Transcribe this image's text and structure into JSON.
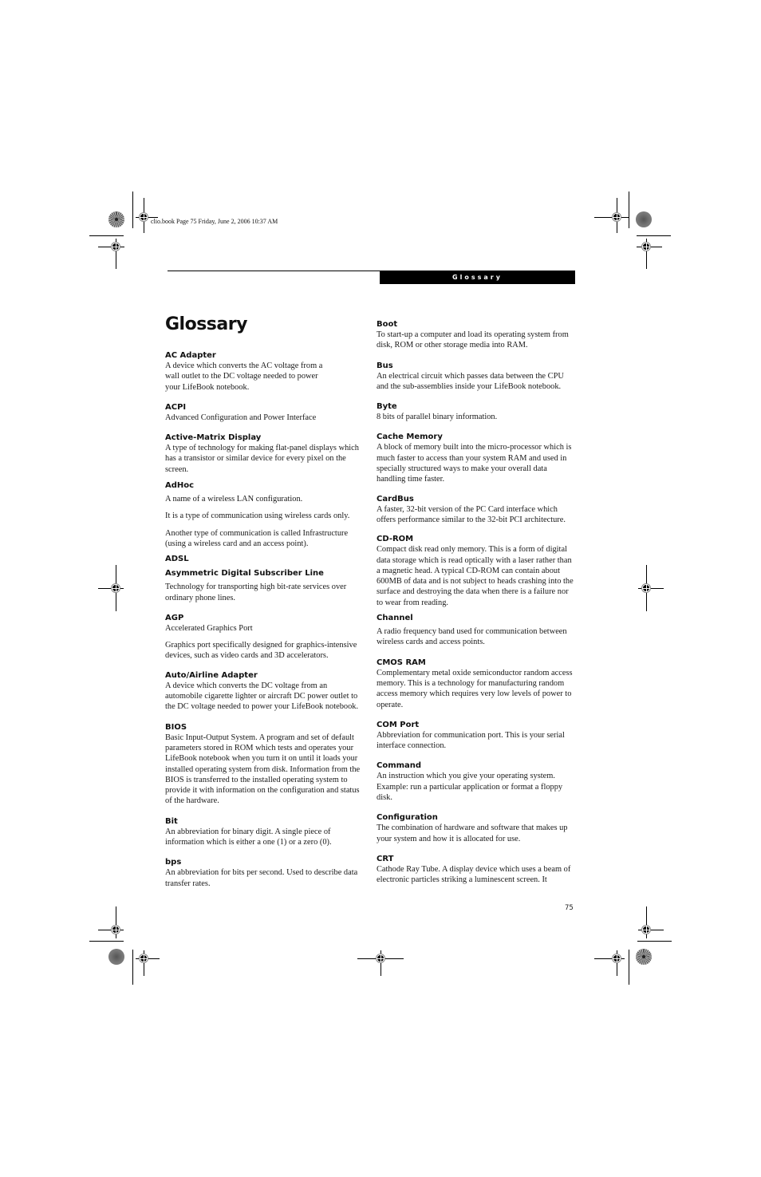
{
  "slug": "clio.book  Page 75  Friday, June 2, 2006  10:37 AM",
  "running_header": "Glossary",
  "page_title": "Glossary",
  "page_number": "75",
  "left_column": [
    {
      "term": "AC Adapter",
      "paragraphs": [
        "A device which converts the AC voltage from a",
        "wall outlet to the DC voltage needed to power",
        "your LifeBook notebook."
      ]
    },
    {
      "term": "ACPI",
      "paragraphs": [
        "Advanced Configuration and Power Interface"
      ]
    },
    {
      "term": "Active-Matrix Display",
      "paragraphs": [
        "A type of technology for making flat-panel displays which has a transistor or similar device for every pixel on the screen."
      ]
    },
    {
      "term": "AdHoc",
      "paragraphs": [
        "A name of a wireless LAN configuration.",
        "It is a type of communication using wireless cards only.",
        "Another type of communication is called Infrastructure (using a wireless card and an access point)."
      ]
    },
    {
      "term": "ADSL",
      "subterm": "Asymmetric Digital Subscriber Line",
      "paragraphs": [
        "Technology for transporting high bit-rate services over ordinary phone lines."
      ]
    },
    {
      "term": "AGP",
      "paragraphs": [
        "Accelerated Graphics Port",
        "Graphics port specifically designed for graphics-intensive devices, such as video cards and 3D accelerators."
      ]
    },
    {
      "term": "Auto/Airline Adapter",
      "paragraphs": [
        "A device which converts the DC voltage from an automobile cigarette lighter or aircraft DC power outlet to the DC voltage needed to power your LifeBook notebook."
      ]
    },
    {
      "term": "BIOS",
      "paragraphs": [
        "Basic Input-Output System. A program and set of default parameters stored in ROM which tests and operates your LifeBook notebook when you turn it on until it loads your installed operating system from disk. Information from the BIOS is transferred to the installed operating system to provide it with information on the configuration and status of the hardware."
      ]
    },
    {
      "term": "Bit",
      "paragraphs": [
        "An abbreviation for binary digit. A single piece of information which is either a one (1) or a zero (0)."
      ]
    },
    {
      "term": "bps",
      "paragraphs": [
        "An abbreviation for bits per second. Used to describe data transfer rates."
      ]
    }
  ],
  "right_column": [
    {
      "term": "Boot",
      "paragraphs": [
        "To start-up a computer and load its operating system from disk, ROM or other storage media into RAM."
      ]
    },
    {
      "term": "Bus",
      "paragraphs": [
        "An electrical circuit which passes data between the CPU and the sub-assemblies inside your LifeBook notebook."
      ]
    },
    {
      "term": "Byte",
      "paragraphs": [
        "8 bits of parallel binary information."
      ]
    },
    {
      "term": "Cache Memory",
      "paragraphs": [
        "A block of memory built into the micro-processor which is much faster to access than your system RAM and used in specially structured ways to make your overall data handling time faster."
      ]
    },
    {
      "term": "CardBus",
      "paragraphs": [
        "A faster, 32-bit version of the PC Card interface which offers performance similar to the 32-bit PCI architecture."
      ]
    },
    {
      "term": "CD-ROM",
      "paragraphs": [
        "Compact disk read only memory. This is a form of digital data storage which is read optically with a laser rather than a magnetic head. A typical CD-ROM can contain about 600MB of data and is not subject to heads crashing into the surface and destroying the data when there is a failure nor to wear from reading."
      ]
    },
    {
      "term": "Channel",
      "paragraphs": [
        "A radio frequency band used for communication between wireless cards and access points."
      ]
    },
    {
      "term": "CMOS RAM",
      "paragraphs": [
        "Complementary metal oxide semiconductor random access memory. This is a technology for manufacturing random access memory which requires very low levels of power to operate."
      ]
    },
    {
      "term": "COM Port",
      "paragraphs": [
        "Abbreviation for communication port. This is your serial interface connection."
      ]
    },
    {
      "term": "Command",
      "paragraphs": [
        "An instruction which you give your operating system. Example: run a particular application or format a floppy disk."
      ]
    },
    {
      "term": "Configuration",
      "paragraphs": [
        "The combination of hardware and software that makes up your system and how it is allocated for use."
      ]
    },
    {
      "term": "CRT",
      "paragraphs": [
        "Cathode Ray Tube. A display device which uses a beam of electronic particles striking a luminescent screen. It"
      ]
    }
  ]
}
